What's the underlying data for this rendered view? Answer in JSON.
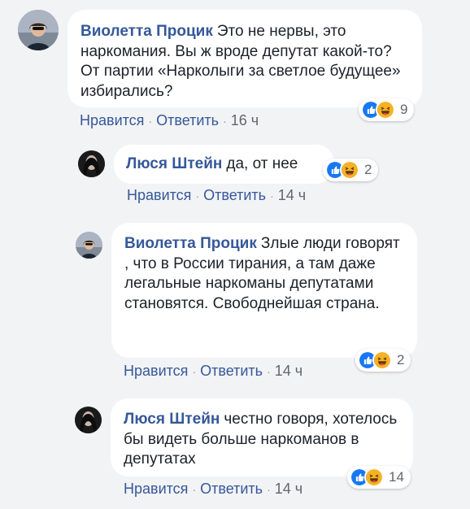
{
  "comments": [
    {
      "author": "Виолетта Процик",
      "text": "Это не нервы, это наркомания. Вы ж вроде депутат какой-то? От партии «Нарколыги за светлое будущее» избирались?",
      "reactions": {
        "count": "9",
        "icons": [
          "like-icon",
          "haha-icon"
        ]
      },
      "actions": {
        "like": "Нравится",
        "reply": "Ответить",
        "time": "16 ч"
      }
    },
    {
      "author": "Люся Штейн",
      "text": "да, от нее",
      "reactions": {
        "count": "2",
        "icons": [
          "like-icon",
          "haha-icon"
        ]
      },
      "actions": {
        "like": "Нравится",
        "reply": "Ответить",
        "time": "14 ч"
      }
    },
    {
      "author": "Виолетта Процик",
      "text": "Злые люди говорят , что в России тирания, а там даже легальные наркоманы депутатами становятся. Свободнейшая страна.",
      "reactions": {
        "count": "2",
        "icons": [
          "like-icon",
          "haha-icon"
        ]
      },
      "actions": {
        "like": "Нравится",
        "reply": "Ответить",
        "time": "14 ч"
      }
    },
    {
      "author": "Люся Штейн",
      "text": "честно говоря, хотелось бы видеть больше наркоманов в депутатах",
      "reactions": {
        "count": "14",
        "icons": [
          "like-icon",
          "haha-icon"
        ]
      },
      "actions": {
        "like": "Нравится",
        "reply": "Ответить",
        "time": "14 ч"
      }
    }
  ],
  "colors": {
    "author": "#365899",
    "like": "#1877f2",
    "haha": "#f7b125",
    "background": "#f2f3f5"
  }
}
